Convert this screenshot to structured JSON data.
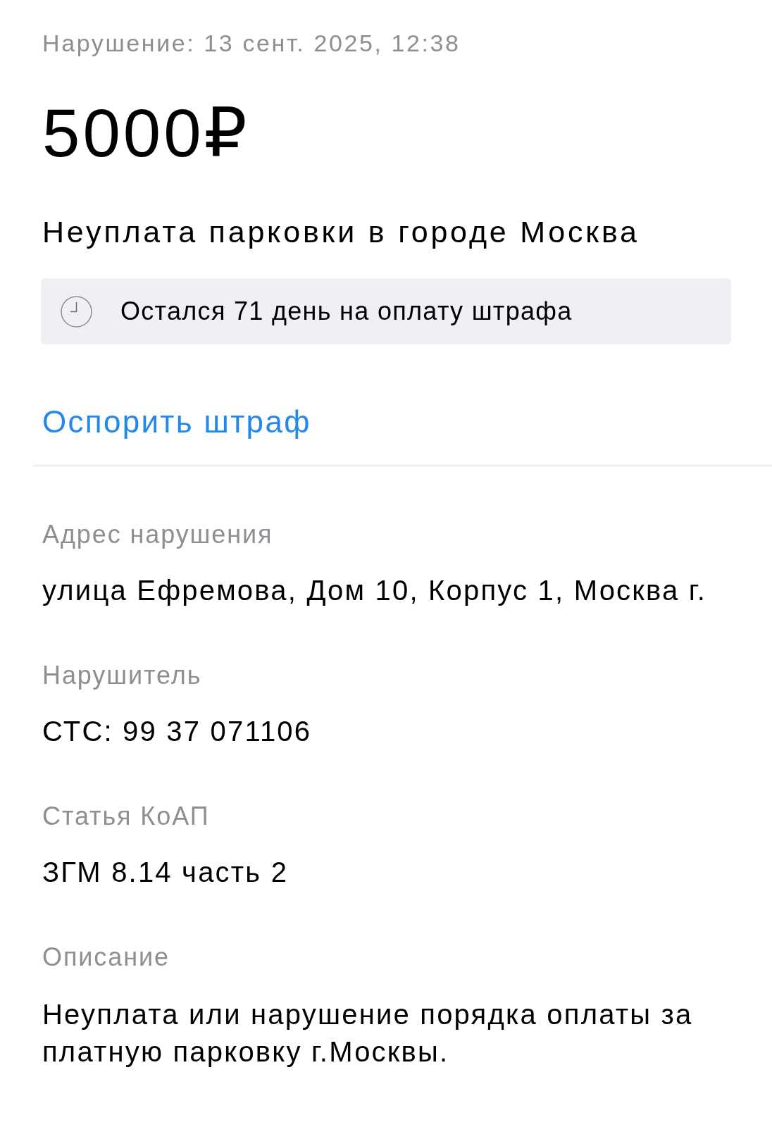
{
  "violation_date": "Нарушение: 13 сент. 2025, 12:38",
  "amount": "5000₽",
  "title": "Неуплата парковки в городе Москва",
  "deadline_banner": {
    "text": "Остался 71 день на оплату штрафа"
  },
  "dispute_link": "Оспорить штраф",
  "details": [
    {
      "label": "Адрес нарушения",
      "value": "улица Ефремова, Дом 10, Корпус 1, Москва г."
    },
    {
      "label": "Нарушитель",
      "value": "СТС: 99 37 071106"
    },
    {
      "label": "Статья КоАП",
      "value": "ЗГМ 8.14 часть 2"
    },
    {
      "label": "Описание",
      "value": "Неуплата или нарушение порядка оплаты за платную парковку г.Москвы."
    }
  ]
}
